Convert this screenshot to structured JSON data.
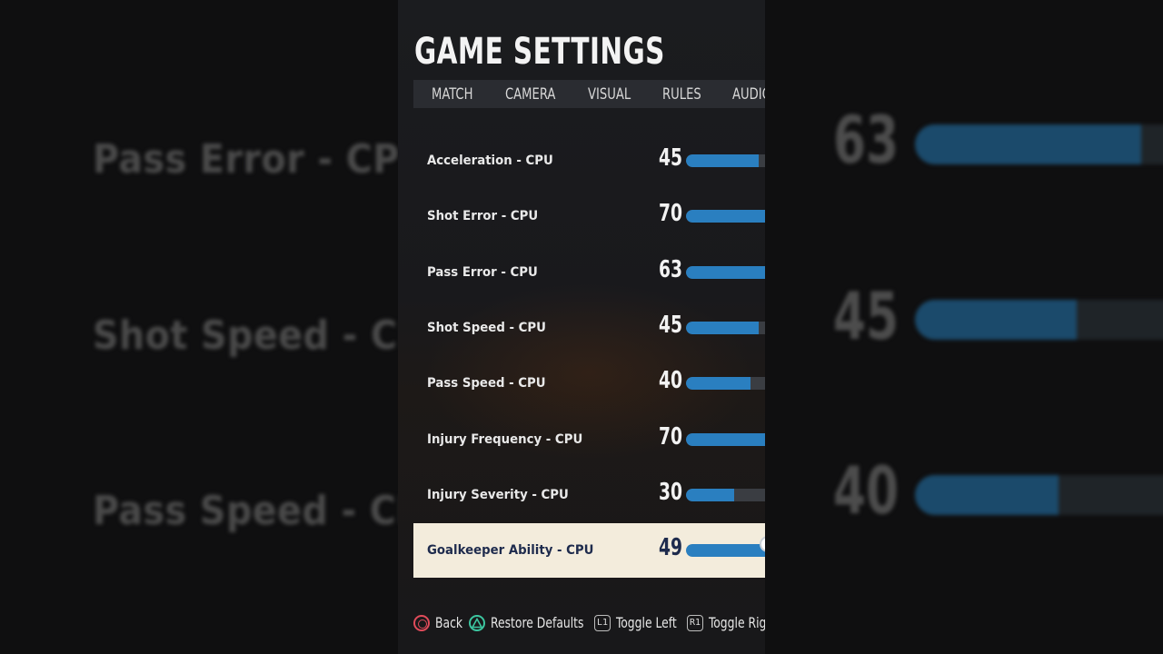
{
  "title": "GAME SETTINGS",
  "tabs": [
    {
      "label": "MATCH"
    },
    {
      "label": "CAMERA"
    },
    {
      "label": "VISUAL"
    },
    {
      "label": "RULES"
    },
    {
      "label": "AUDIO"
    }
  ],
  "settings": [
    {
      "label": "Acceleration - CPU",
      "value": "45",
      "percent": 45
    },
    {
      "label": "Shot Error - CPU",
      "value": "70",
      "percent": 70
    },
    {
      "label": "Pass Error - CPU",
      "value": "63",
      "percent": 63
    },
    {
      "label": "Shot Speed - CPU",
      "value": "45",
      "percent": 45
    },
    {
      "label": "Pass Speed - CPU",
      "value": "40",
      "percent": 40
    },
    {
      "label": "Injury Frequency - CPU",
      "value": "70",
      "percent": 70
    },
    {
      "label": "Injury Severity - CPU",
      "value": "30",
      "percent": 30
    },
    {
      "label": "Goalkeeper Ability - CPU",
      "value": "49",
      "percent": 49,
      "selected": true
    }
  ],
  "footer": {
    "back": "Back",
    "restore": "Restore Defaults",
    "l1_button": "L1",
    "toggle_left": "Toggle Left",
    "r1_button": "R1",
    "toggle_right": "Toggle Right"
  },
  "background_left": {
    "labels": [
      "Pass Error - CPU",
      "Shot Speed - CPU",
      "Pass Speed - CPU"
    ]
  },
  "background_right": {
    "items": [
      {
        "value": "63",
        "percent": 63
      },
      {
        "value": "45",
        "percent": 45
      },
      {
        "value": "40",
        "percent": 40
      }
    ]
  },
  "colors": {
    "accent_blue": "#2a7fc0",
    "selected_row": "#f3ecdc",
    "circle_button": "#e04b5a",
    "triangle_button": "#3cc6a0"
  }
}
